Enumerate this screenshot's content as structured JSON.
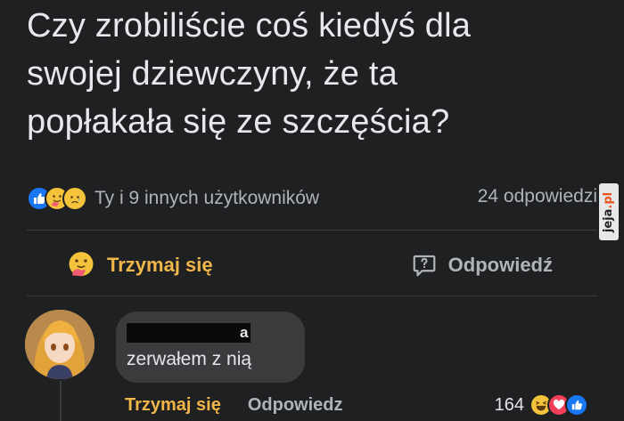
{
  "post": {
    "text_line1": "Czy zrobiliście coś kiedyś dla",
    "text_line2": "swojej dziewczyny, że ta",
    "text_line3": "popłakała się ze szczęścia?"
  },
  "reactions": {
    "icons": [
      "like-icon",
      "care-icon",
      "sad-icon"
    ],
    "summary": "Ty i 9 innych użytkowników",
    "replies": "24 odpowiedzi"
  },
  "actions": {
    "care_label": "Trzymaj się",
    "reply_label": "Odpowiedź"
  },
  "comment": {
    "author_visible_suffix": "a",
    "text": "zerwałem z nią",
    "care_label": "Trzymaj się",
    "reply_label": "Odpowiedz",
    "reaction_count": "164",
    "reaction_icons": [
      "haha-icon",
      "love-icon",
      "like-icon"
    ]
  },
  "watermark": {
    "text_main": "jeja",
    "text_suffix": ".pl"
  },
  "colors": {
    "background": "#1f2021",
    "care_accent": "#f0b64a",
    "like_blue": "#1877f2",
    "text_primary": "#e6e8eb",
    "text_secondary": "#b0b3b8"
  }
}
